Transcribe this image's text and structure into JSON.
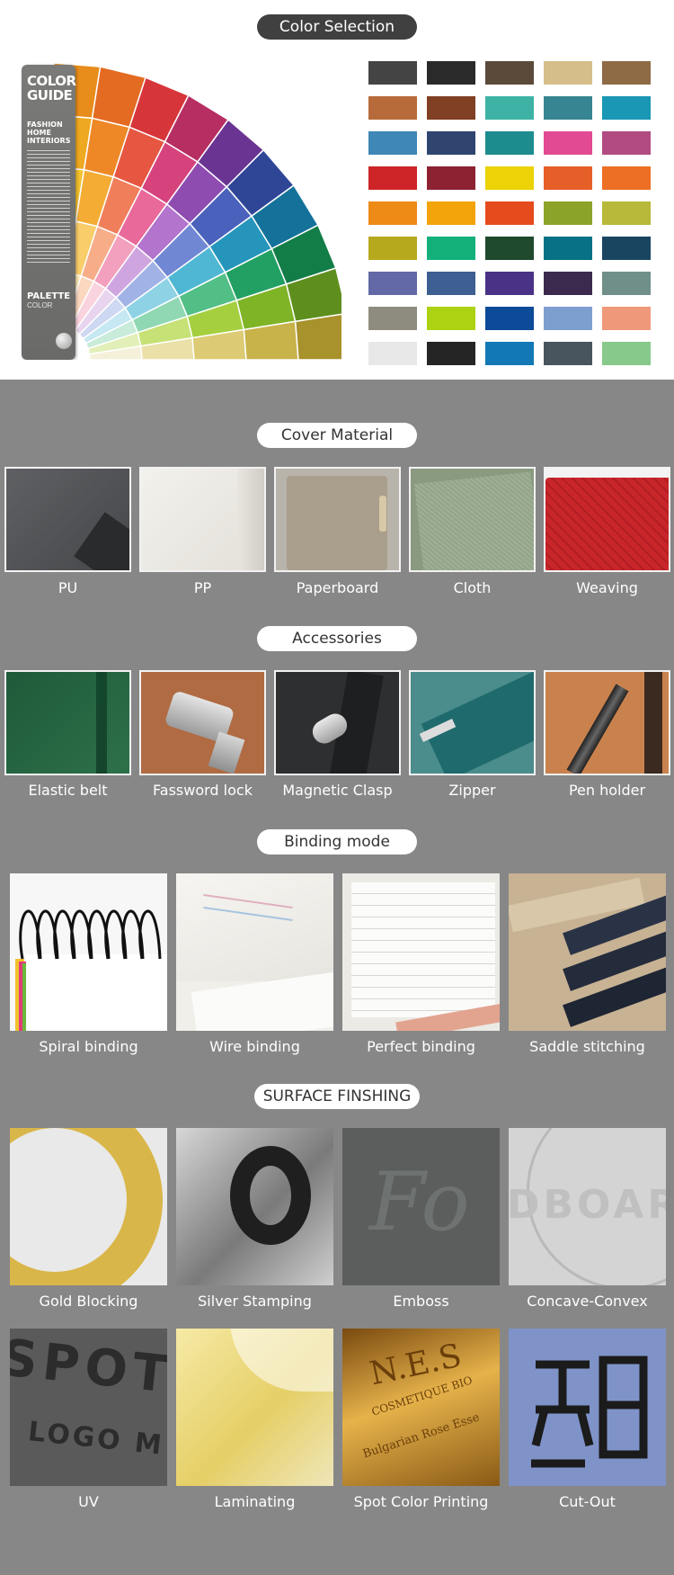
{
  "color_selection": {
    "title": "Color Selection",
    "guide": {
      "title_line1": "COLOR",
      "title_line2": "GUIDE",
      "subtitle_line1": "FASHION",
      "subtitle_line2": "HOME",
      "subtitle_line3": "INTERIORS",
      "brand": "PALETTE",
      "brand_sub": "COLOR"
    },
    "swatches": [
      [
        "#444444",
        "#2a2a2a",
        "#5b4a3a",
        "#d6be8a",
        "#8e6a45"
      ],
      [
        "#b86b3a",
        "#813f24",
        "#3eb3a5",
        "#378592",
        "#1997b5"
      ],
      [
        "#3f87b6",
        "#2f4570",
        "#1d8c8f",
        "#e24a93",
        "#b14b82"
      ],
      [
        "#cd2428",
        "#8d2232",
        "#ecd207",
        "#e75f28",
        "#ec6f24"
      ],
      [
        "#ee8a16",
        "#f2a40a",
        "#e64b1e",
        "#8ba328",
        "#b8b83a"
      ],
      [
        "#b6a91e",
        "#13b07a",
        "#1f4a2d",
        "#087186",
        "#1a4561"
      ],
      [
        "#6269a6",
        "#3d5f91",
        "#4a3387",
        "#3b2a4d",
        "#6f8f88"
      ],
      [
        "#8e8c7e",
        "#acd212",
        "#0d4b98",
        "#7d9fd0",
        "#f0987a"
      ],
      [
        "#e8e8e8",
        "#252525",
        "#1379b6",
        "#48555f",
        "#86c98a"
      ]
    ]
  },
  "cover_material": {
    "title": "Cover Material",
    "items": [
      "PU",
      "PP",
      "Paperboard",
      "Cloth",
      "Weaving"
    ]
  },
  "accessories": {
    "title": "Accessories",
    "items": [
      "Elastic belt",
      "Fassword lock",
      "Magnetic Clasp",
      "Zipper",
      "Pen holder"
    ]
  },
  "binding_mode": {
    "title": "Binding mode",
    "items": [
      "Spiral binding",
      "Wire binding",
      "Perfect binding",
      "Saddle stitching"
    ]
  },
  "surface_finishing": {
    "title": "SURFACE FINSHING",
    "row1": [
      "Gold Blocking",
      "Silver Stamping",
      "Emboss",
      "Concave-Convex"
    ],
    "row2": [
      "UV",
      "Laminating",
      "Spot Color Printing",
      "Cut-Out"
    ],
    "image_text": {
      "spot": "SPOT",
      "logo": "LOGO M",
      "nes": "N.E.S",
      "cosmetique": "COSMETIQUE BIO",
      "rose": "Bulgarian Rose Esse",
      "board": "DBOAR"
    }
  }
}
